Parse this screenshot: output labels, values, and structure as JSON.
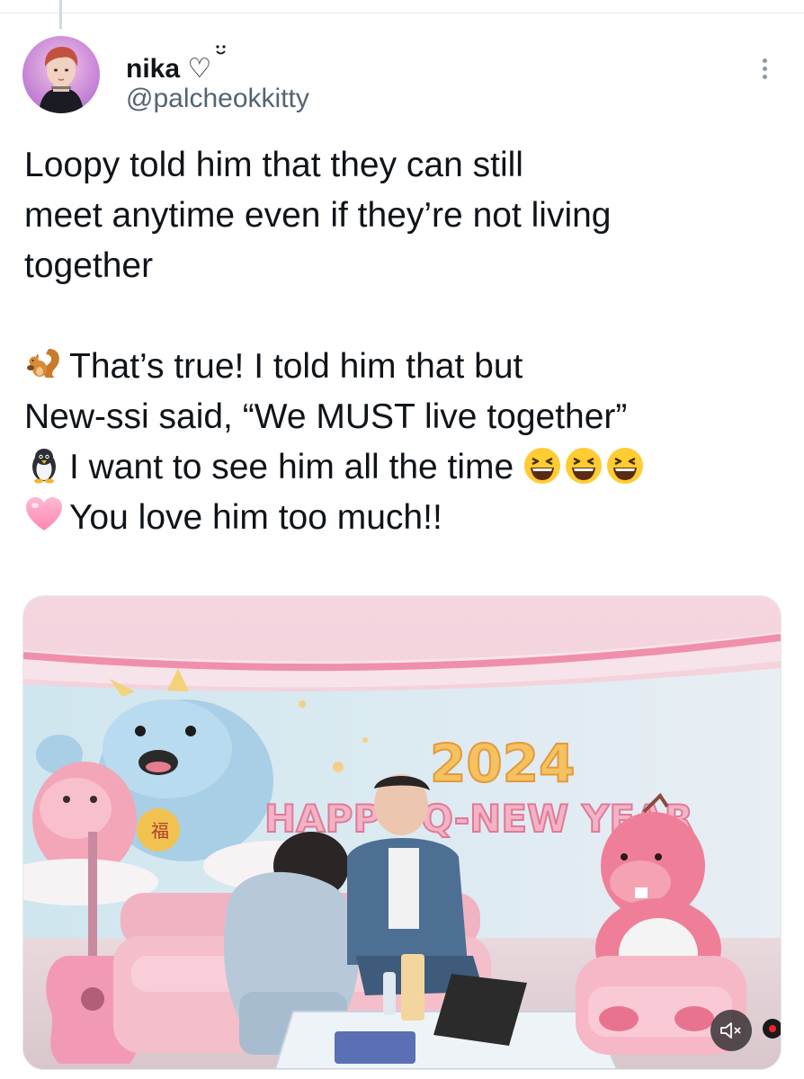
{
  "author": {
    "display_name": "nika ♡",
    "handle": "@palcheokkitty",
    "avatar_icon": "avatar-photo"
  },
  "tweet": {
    "lines": [
      "Loopy told him that they can still",
      "meet anytime even if they’re not living",
      "together",
      "",
      "That’s true! I told him that but",
      "New-ssi said, “We MUST live together”",
      "I want to see him all the time",
      "You love him too much!!"
    ],
    "emoji": {
      "line5_prefix": "squirrel-emoji",
      "line7_prefix": "penguin-emoji",
      "line7_suffix": [
        "laughing-emoji",
        "laughing-emoji",
        "laughing-emoji"
      ],
      "line8_prefix": "pink-heart-emoji"
    }
  },
  "media": {
    "banner_year": "2024",
    "banner_text": "HAPPY Q-NEW YEAR",
    "mute_icon": "speaker-muted-icon"
  },
  "colors": {
    "text": "#0f1419",
    "secondary": "#536471",
    "pink": "#f3b3c5"
  }
}
